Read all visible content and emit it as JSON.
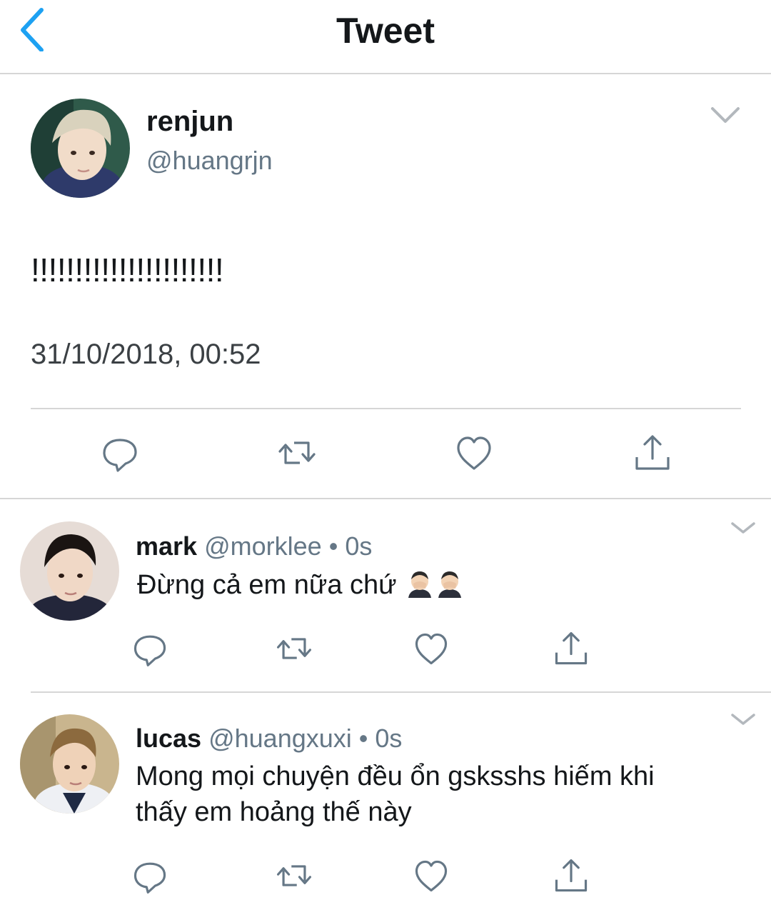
{
  "header": {
    "title": "Tweet",
    "back_icon": "chevron-left-icon",
    "accent_color": "#1da1f2"
  },
  "main_tweet": {
    "author_name": "renjun",
    "author_handle": "@huangrjn",
    "text": "!!!!!!!!!!!!!!!!!!!!!!",
    "timestamp": "31/10/2018, 00:52",
    "actions": [
      "reply-icon",
      "retweet-icon",
      "like-icon",
      "share-icon"
    ]
  },
  "replies": [
    {
      "name": "mark",
      "handle": "@morklee",
      "separator": "•",
      "time": "0s",
      "text": "Đừng cả em nữa chứ",
      "emoji": [
        "face-palm-emoji",
        "face-palm-emoji"
      ]
    },
    {
      "name": "lucas",
      "handle": "@huangxuxi",
      "separator": "•",
      "time": "0s",
      "text_line1": "Mong mọi chuyện đều ổn gsksshs hiếm khi",
      "text_line2": "thấy em hoảng thế này"
    }
  ],
  "colors": {
    "icon_gray": "#657786",
    "divider": "#d6d6d6",
    "secondary_text": "#657786"
  }
}
